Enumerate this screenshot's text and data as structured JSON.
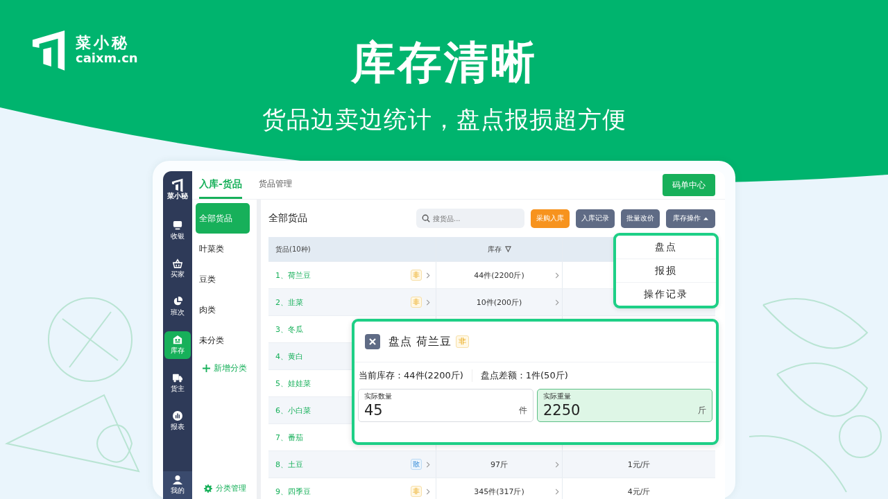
{
  "brand": {
    "name": "菜小秘",
    "site": "caixm.cn"
  },
  "headline": "库存清晰",
  "subheadline": "货品边卖边统计，盘点报损超方便",
  "app": {
    "nav_logo": "菜小秘",
    "nav": [
      {
        "label": "收银",
        "selected": false
      },
      {
        "label": "买家",
        "selected": false
      },
      {
        "label": "班次",
        "selected": false
      },
      {
        "label": "库存",
        "selected": true
      },
      {
        "label": "货主",
        "selected": false
      },
      {
        "label": "报表",
        "selected": false
      }
    ],
    "nav_bottom": {
      "label": "我的"
    },
    "tabs": [
      {
        "label": "入库-货品",
        "selected": true
      },
      {
        "label": "货品管理",
        "selected": false
      }
    ],
    "top_button": "码单中心",
    "categories": [
      {
        "label": "全部货品",
        "selected": true
      },
      {
        "label": "叶菜类",
        "selected": false
      },
      {
        "label": "豆类",
        "selected": false
      },
      {
        "label": "肉类",
        "selected": false
      },
      {
        "label": "未分类",
        "selected": false
      }
    ],
    "add_category": "新增分类",
    "manage_categories": "分类管理",
    "list_title": "全部货品",
    "search": {
      "placeholder": "搜货品..."
    },
    "actions": [
      {
        "label": "采购入库",
        "kind": "primary"
      },
      {
        "label": "入库记录",
        "kind": "secondary"
      },
      {
        "label": "批量改价",
        "kind": "secondary"
      },
      {
        "label": "库存操作",
        "kind": "menu",
        "expanded": true
      }
    ],
    "table": {
      "columns": [
        "货品(10种)",
        "库存"
      ],
      "rows": [
        {
          "name": "1、荷兰豆",
          "tag": {
            "text": "非",
            "kind": "nonstandard"
          },
          "stock": "44件(2200斤)"
        },
        {
          "name": "2、韭菜",
          "tag": {
            "text": "非",
            "kind": "nonstandard"
          },
          "stock": "10件(200斤)"
        },
        {
          "name": "3、冬瓜"
        },
        {
          "name": "4、黄白"
        },
        {
          "name": "5、娃娃菜"
        },
        {
          "name": "6、小白菜"
        },
        {
          "name": "7、番茄"
        },
        {
          "name": "8、土豆",
          "tag": {
            "text": "散",
            "kind": "bulk"
          },
          "stock": "97斤",
          "price": "1元/斤"
        },
        {
          "name": "9、四季豆",
          "tag": {
            "text": "非",
            "kind": "nonstandard"
          },
          "stock": "345件(317斤)",
          "price": "4元/斤"
        }
      ]
    },
    "menu": [
      "盘点",
      "报损",
      "操作记录"
    ],
    "dialog": {
      "title": "盘点 荷兰豆",
      "tag": {
        "text": "非",
        "kind": "nonstandard"
      },
      "info": [
        "当前库存：44件(2200斤)",
        "盘点差额：1件(50斤)"
      ],
      "fields": [
        {
          "label": "实际数量",
          "value": "45",
          "unit": "件",
          "focused": false
        },
        {
          "label": "实际重量",
          "value": "2250",
          "unit": "斤",
          "focused": true
        }
      ]
    }
  }
}
